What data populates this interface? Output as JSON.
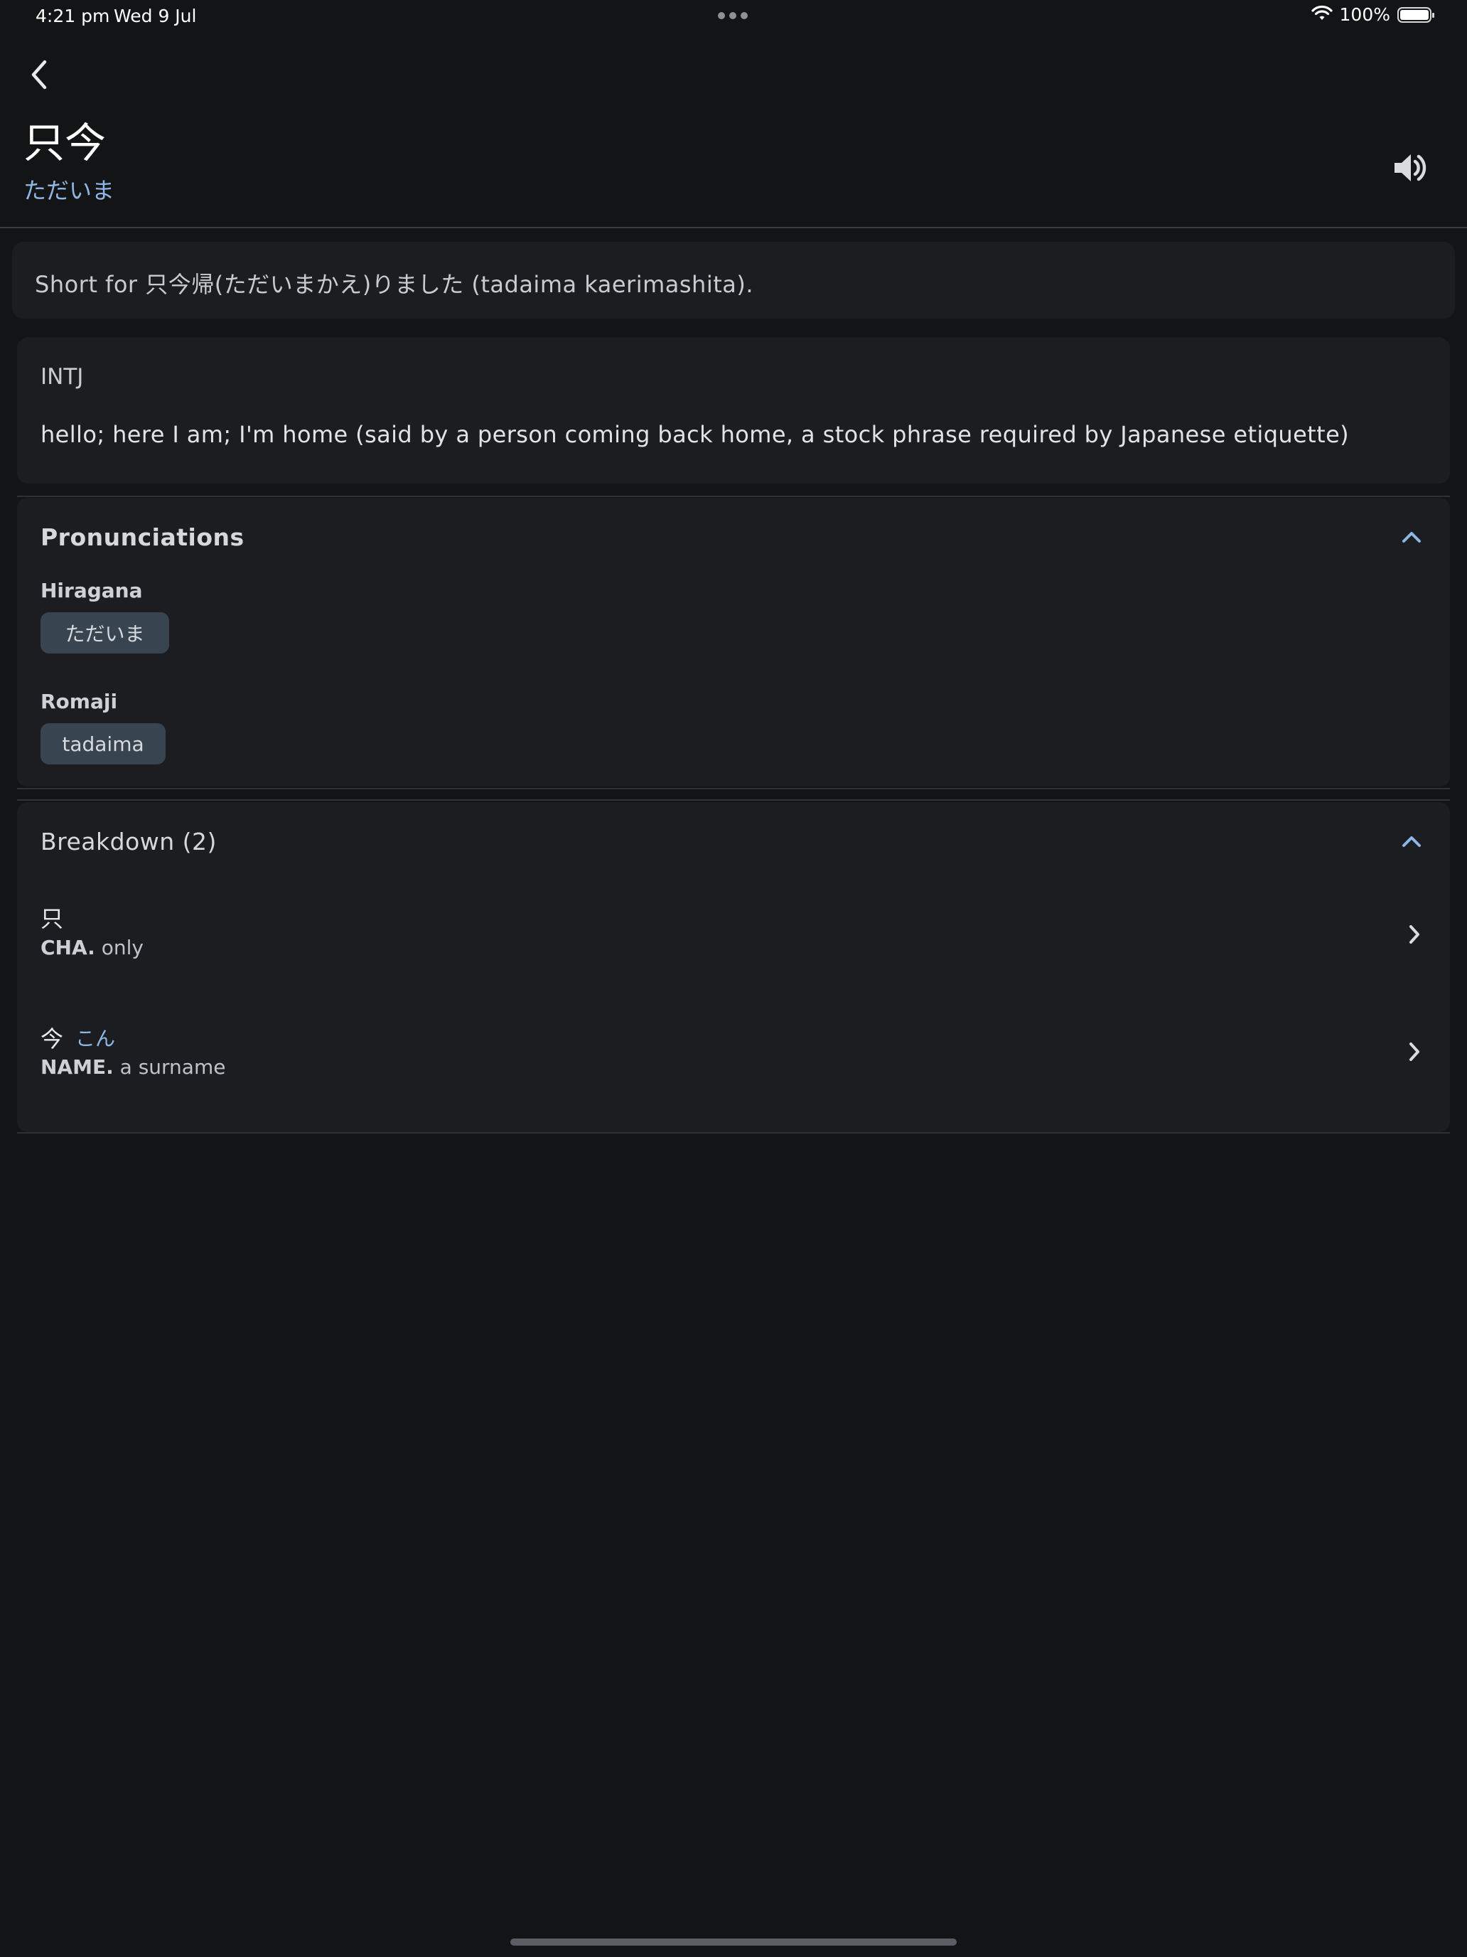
{
  "status_bar": {
    "time": "4:21 pm",
    "date": "Wed 9 Jul",
    "battery": "100%"
  },
  "header": {
    "word": "只今",
    "reading": "ただいま"
  },
  "note": {
    "text": "Short for 只今帰(ただいまかえ)りました (tadaima kaerimashita)."
  },
  "sense": {
    "pos": "INTJ",
    "gloss": "hello; here I am; I'm home (said by a person coming back home, a stock phrase required by Japanese etiquette)"
  },
  "pronunciations": {
    "title": "Pronunciations",
    "hiragana_label": "Hiragana",
    "hiragana_value": "ただいま",
    "romaji_label": "Romaji",
    "romaji_value": "tadaima"
  },
  "breakdown": {
    "title": "Breakdown (2)",
    "items": [
      {
        "kanji": "只",
        "reading": "",
        "tag": "CHA.",
        "meaning": "only"
      },
      {
        "kanji": "今",
        "reading": "こん",
        "tag": "NAME.",
        "meaning": "a surname"
      }
    ]
  },
  "colors": {
    "background": "#131416",
    "card": "#1b1d21",
    "accent": "#8fb7e6",
    "pill": "#384450"
  },
  "icons": [
    "wifi-icon",
    "battery-icon",
    "back-chevron-icon",
    "speaker-icon",
    "chevron-up-icon",
    "chevron-right-icon"
  ]
}
